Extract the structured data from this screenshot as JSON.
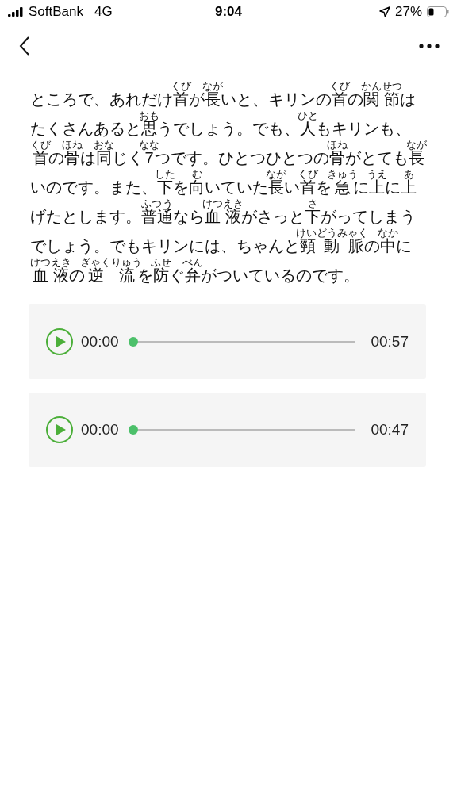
{
  "status_bar": {
    "carrier": "SoftBank",
    "network": "4G",
    "time": "9:04",
    "battery": "27%"
  },
  "paragraph": [
    {
      "text": "ところで、あれだけ"
    },
    {
      "text": "首",
      "ruby": "くび"
    },
    {
      "text": "が"
    },
    {
      "text": "長",
      "ruby": "なが"
    },
    {
      "text": "いと、キリンの"
    },
    {
      "text": "首",
      "ruby": "くび"
    },
    {
      "text": "の"
    },
    {
      "text": "関節",
      "ruby": "かんせつ"
    },
    {
      "text": "はたくさんあると"
    },
    {
      "text": "思",
      "ruby": "おも"
    },
    {
      "text": "うでしょう。でも、"
    },
    {
      "text": "人",
      "ruby": "ひと"
    },
    {
      "text": "もキリンも、"
    },
    {
      "text": "首",
      "ruby": "くび"
    },
    {
      "text": "の"
    },
    {
      "text": "骨",
      "ruby": "ほね"
    },
    {
      "text": "は"
    },
    {
      "text": "同",
      "ruby": "おな"
    },
    {
      "text": "じく"
    },
    {
      "text": "7",
      "ruby": "なな"
    },
    {
      "text": "つです。ひとつひとつの"
    },
    {
      "text": "骨",
      "ruby": "ほね"
    },
    {
      "text": "がとても"
    },
    {
      "text": "長",
      "ruby": "なが"
    },
    {
      "text": "いのです。また、"
    },
    {
      "text": "下",
      "ruby": "した"
    },
    {
      "text": "を"
    },
    {
      "text": "向",
      "ruby": "む"
    },
    {
      "text": "いていた"
    },
    {
      "text": "長",
      "ruby": "なが"
    },
    {
      "text": "い"
    },
    {
      "text": "首",
      "ruby": "くび"
    },
    {
      "text": "を"
    },
    {
      "text": "急",
      "ruby": "きゅう"
    },
    {
      "text": "に"
    },
    {
      "text": "上",
      "ruby": "うえ"
    },
    {
      "text": "に"
    },
    {
      "text": "上",
      "ruby": "あ"
    },
    {
      "text": "げたとします。"
    },
    {
      "text": "普通",
      "ruby": "ふつう"
    },
    {
      "text": "なら"
    },
    {
      "text": "血液",
      "ruby": "けつえき"
    },
    {
      "text": "がさっと"
    },
    {
      "text": "下",
      "ruby": "さ"
    },
    {
      "text": "がってしまうでしょう。でもキリンには、ちゃんと"
    },
    {
      "text": "頸動脈",
      "ruby": "けいどうみゃく"
    },
    {
      "text": "の"
    },
    {
      "text": "中",
      "ruby": "なか"
    },
    {
      "text": "に"
    },
    {
      "text": "血液",
      "ruby": "けつえき"
    },
    {
      "text": "の"
    },
    {
      "text": "逆流",
      "ruby": "ぎゃくりゅう"
    },
    {
      "text": "を"
    },
    {
      "text": "防",
      "ruby": "ふせ"
    },
    {
      "text": "ぐ"
    },
    {
      "text": "弁",
      "ruby": "べん"
    },
    {
      "text": "がついているのです。"
    }
  ],
  "audio_players": [
    {
      "current": "00:00",
      "duration": "00:57",
      "level": 0
    },
    {
      "current": "00:00",
      "duration": "00:47",
      "level": 0
    }
  ]
}
